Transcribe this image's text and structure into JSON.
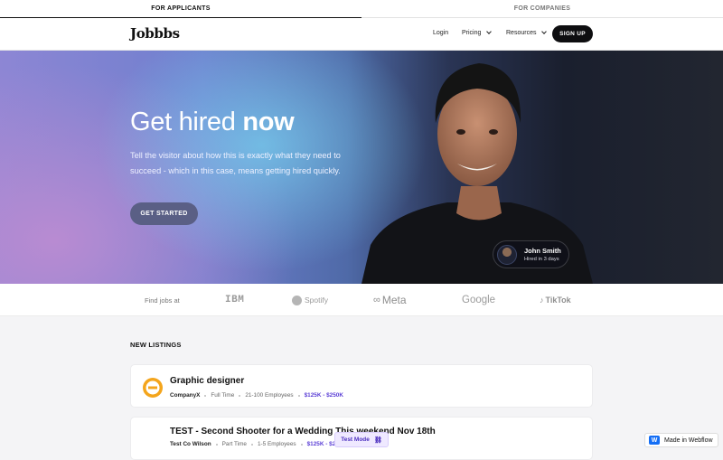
{
  "top_tabs": [
    "FOR APPLICANTS",
    "FOR COMPANIES"
  ],
  "nav": {
    "logo": "Jobbbs",
    "login": "Login",
    "pricing": "Pricing",
    "resources": "Resources",
    "signup": "SIGN UP"
  },
  "hero": {
    "title_regular": "Get hired ",
    "title_bold": "now",
    "lead": "Tell the visitor about how this is exactly what they need to succeed - which in this case, means getting hired quickly.",
    "cta": "GET STARTED",
    "testimonial": {
      "name": "John Smith",
      "subtitle": "Hired in 3 days"
    }
  },
  "logos": {
    "label": "Find jobs at",
    "brands": [
      "IBM",
      "Spotify",
      "Meta",
      "Google",
      "TikTok"
    ]
  },
  "listings": {
    "heading": "NEW LISTINGS",
    "items": [
      {
        "title": "Graphic designer",
        "company": "CompanyX",
        "type": "Full Time",
        "size": "21-100 Employees",
        "salary": "$125K - $250K"
      },
      {
        "title": "TEST - Second Shooter for a Wedding This weekend Nov 18th",
        "company": "Test Co Wilson",
        "type": "Part Time",
        "size": "1-5 Employees",
        "salary": "$125K - $25"
      }
    ]
  },
  "badges": {
    "test_mode": "Test Mode",
    "made_in_webflow": "Made in Webflow"
  },
  "colors": {
    "accent": "#5b3fd6",
    "dark": "#0e0e10",
    "webflow": "#146ef5"
  }
}
